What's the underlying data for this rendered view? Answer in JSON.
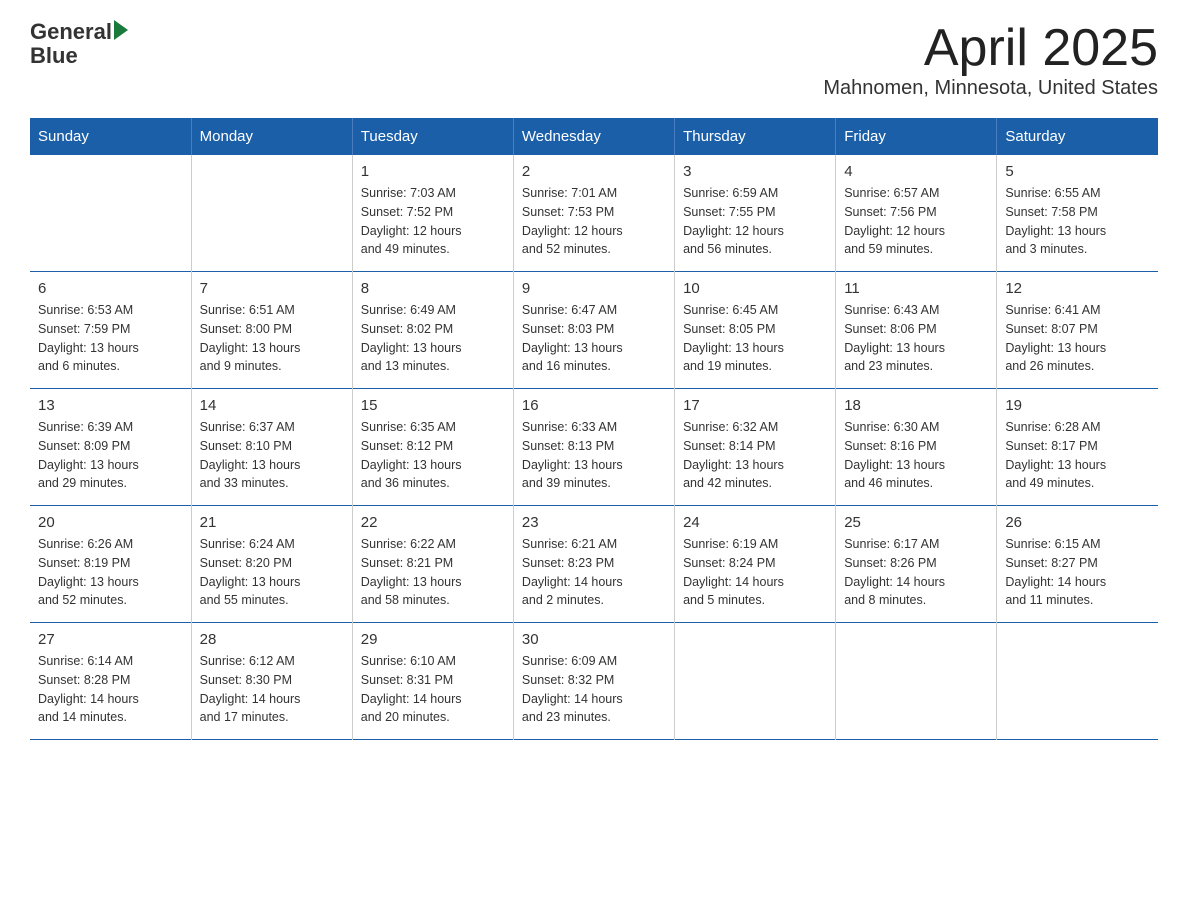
{
  "header": {
    "logo_general": "General",
    "logo_blue": "Blue",
    "title": "April 2025",
    "subtitle": "Mahnomen, Minnesota, United States"
  },
  "days_of_week": [
    "Sunday",
    "Monday",
    "Tuesday",
    "Wednesday",
    "Thursday",
    "Friday",
    "Saturday"
  ],
  "weeks": [
    [
      {
        "day": "",
        "info": ""
      },
      {
        "day": "",
        "info": ""
      },
      {
        "day": "1",
        "info": "Sunrise: 7:03 AM\nSunset: 7:52 PM\nDaylight: 12 hours\nand 49 minutes."
      },
      {
        "day": "2",
        "info": "Sunrise: 7:01 AM\nSunset: 7:53 PM\nDaylight: 12 hours\nand 52 minutes."
      },
      {
        "day": "3",
        "info": "Sunrise: 6:59 AM\nSunset: 7:55 PM\nDaylight: 12 hours\nand 56 minutes."
      },
      {
        "day": "4",
        "info": "Sunrise: 6:57 AM\nSunset: 7:56 PM\nDaylight: 12 hours\nand 59 minutes."
      },
      {
        "day": "5",
        "info": "Sunrise: 6:55 AM\nSunset: 7:58 PM\nDaylight: 13 hours\nand 3 minutes."
      }
    ],
    [
      {
        "day": "6",
        "info": "Sunrise: 6:53 AM\nSunset: 7:59 PM\nDaylight: 13 hours\nand 6 minutes."
      },
      {
        "day": "7",
        "info": "Sunrise: 6:51 AM\nSunset: 8:00 PM\nDaylight: 13 hours\nand 9 minutes."
      },
      {
        "day": "8",
        "info": "Sunrise: 6:49 AM\nSunset: 8:02 PM\nDaylight: 13 hours\nand 13 minutes."
      },
      {
        "day": "9",
        "info": "Sunrise: 6:47 AM\nSunset: 8:03 PM\nDaylight: 13 hours\nand 16 minutes."
      },
      {
        "day": "10",
        "info": "Sunrise: 6:45 AM\nSunset: 8:05 PM\nDaylight: 13 hours\nand 19 minutes."
      },
      {
        "day": "11",
        "info": "Sunrise: 6:43 AM\nSunset: 8:06 PM\nDaylight: 13 hours\nand 23 minutes."
      },
      {
        "day": "12",
        "info": "Sunrise: 6:41 AM\nSunset: 8:07 PM\nDaylight: 13 hours\nand 26 minutes."
      }
    ],
    [
      {
        "day": "13",
        "info": "Sunrise: 6:39 AM\nSunset: 8:09 PM\nDaylight: 13 hours\nand 29 minutes."
      },
      {
        "day": "14",
        "info": "Sunrise: 6:37 AM\nSunset: 8:10 PM\nDaylight: 13 hours\nand 33 minutes."
      },
      {
        "day": "15",
        "info": "Sunrise: 6:35 AM\nSunset: 8:12 PM\nDaylight: 13 hours\nand 36 minutes."
      },
      {
        "day": "16",
        "info": "Sunrise: 6:33 AM\nSunset: 8:13 PM\nDaylight: 13 hours\nand 39 minutes."
      },
      {
        "day": "17",
        "info": "Sunrise: 6:32 AM\nSunset: 8:14 PM\nDaylight: 13 hours\nand 42 minutes."
      },
      {
        "day": "18",
        "info": "Sunrise: 6:30 AM\nSunset: 8:16 PM\nDaylight: 13 hours\nand 46 minutes."
      },
      {
        "day": "19",
        "info": "Sunrise: 6:28 AM\nSunset: 8:17 PM\nDaylight: 13 hours\nand 49 minutes."
      }
    ],
    [
      {
        "day": "20",
        "info": "Sunrise: 6:26 AM\nSunset: 8:19 PM\nDaylight: 13 hours\nand 52 minutes."
      },
      {
        "day": "21",
        "info": "Sunrise: 6:24 AM\nSunset: 8:20 PM\nDaylight: 13 hours\nand 55 minutes."
      },
      {
        "day": "22",
        "info": "Sunrise: 6:22 AM\nSunset: 8:21 PM\nDaylight: 13 hours\nand 58 minutes."
      },
      {
        "day": "23",
        "info": "Sunrise: 6:21 AM\nSunset: 8:23 PM\nDaylight: 14 hours\nand 2 minutes."
      },
      {
        "day": "24",
        "info": "Sunrise: 6:19 AM\nSunset: 8:24 PM\nDaylight: 14 hours\nand 5 minutes."
      },
      {
        "day": "25",
        "info": "Sunrise: 6:17 AM\nSunset: 8:26 PM\nDaylight: 14 hours\nand 8 minutes."
      },
      {
        "day": "26",
        "info": "Sunrise: 6:15 AM\nSunset: 8:27 PM\nDaylight: 14 hours\nand 11 minutes."
      }
    ],
    [
      {
        "day": "27",
        "info": "Sunrise: 6:14 AM\nSunset: 8:28 PM\nDaylight: 14 hours\nand 14 minutes."
      },
      {
        "day": "28",
        "info": "Sunrise: 6:12 AM\nSunset: 8:30 PM\nDaylight: 14 hours\nand 17 minutes."
      },
      {
        "day": "29",
        "info": "Sunrise: 6:10 AM\nSunset: 8:31 PM\nDaylight: 14 hours\nand 20 minutes."
      },
      {
        "day": "30",
        "info": "Sunrise: 6:09 AM\nSunset: 8:32 PM\nDaylight: 14 hours\nand 23 minutes."
      },
      {
        "day": "",
        "info": ""
      },
      {
        "day": "",
        "info": ""
      },
      {
        "day": "",
        "info": ""
      }
    ]
  ]
}
